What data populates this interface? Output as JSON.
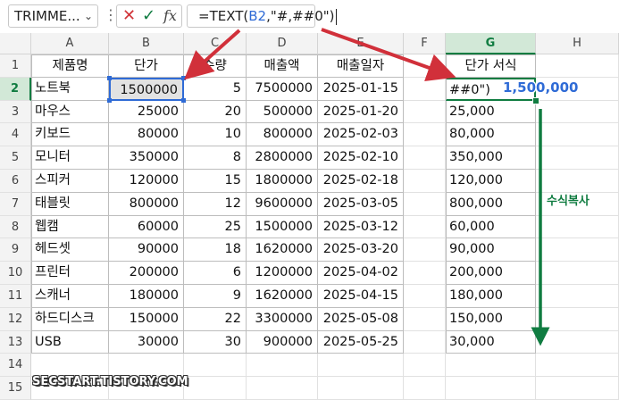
{
  "formula_bar": {
    "name_box": "TRIMME...",
    "formula_prefix": "=TEXT(",
    "formula_ref": "B2",
    "formula_suffix": ",\"#,##0\")"
  },
  "columns": [
    "A",
    "B",
    "C",
    "D",
    "E",
    "F",
    "G",
    "H"
  ],
  "rows": [
    "1",
    "2",
    "3",
    "4",
    "5",
    "6",
    "7",
    "8",
    "9",
    "10",
    "11",
    "12",
    "13",
    "14",
    "15"
  ],
  "headers": {
    "product": "제품명",
    "price": "단가",
    "qty": "수량",
    "sales": "매출액",
    "date": "매출일자",
    "price_format": "단가 서식"
  },
  "table": [
    {
      "product": "노트북",
      "price": "1500000",
      "qty": "5",
      "sales": "7500000",
      "date": "2025-01-15",
      "formatted": "##0\")"
    },
    {
      "product": "마우스",
      "price": "25000",
      "qty": "20",
      "sales": "500000",
      "date": "2025-01-20",
      "formatted": "25,000"
    },
    {
      "product": "키보드",
      "price": "80000",
      "qty": "10",
      "sales": "800000",
      "date": "2025-02-03",
      "formatted": "80,000"
    },
    {
      "product": "모니터",
      "price": "350000",
      "qty": "8",
      "sales": "2800000",
      "date": "2025-02-10",
      "formatted": "350,000"
    },
    {
      "product": "스피커",
      "price": "120000",
      "qty": "15",
      "sales": "1800000",
      "date": "2025-02-18",
      "formatted": "120,000"
    },
    {
      "product": "태블릿",
      "price": "800000",
      "qty": "12",
      "sales": "9600000",
      "date": "2025-03-05",
      "formatted": "800,000"
    },
    {
      "product": "웹캠",
      "price": "60000",
      "qty": "25",
      "sales": "1500000",
      "date": "2025-03-12",
      "formatted": "60,000"
    },
    {
      "product": "헤드셋",
      "price": "90000",
      "qty": "18",
      "sales": "1620000",
      "date": "2025-03-20",
      "formatted": "90,000"
    },
    {
      "product": "프린터",
      "price": "200000",
      "qty": "6",
      "sales": "1200000",
      "date": "2025-04-02",
      "formatted": "200,000"
    },
    {
      "product": "스캐너",
      "price": "180000",
      "qty": "9",
      "sales": "1620000",
      "date": "2025-04-15",
      "formatted": "180,000"
    },
    {
      "product": "하드디스크",
      "price": "150000",
      "qty": "22",
      "sales": "3300000",
      "date": "2025-05-08",
      "formatted": "150,000"
    },
    {
      "product": "USB",
      "price": "30000",
      "qty": "30",
      "sales": "900000",
      "date": "2025-05-25",
      "formatted": "30,000"
    }
  ],
  "annotations": {
    "result_preview": "1,500,000",
    "copy_formula": "수식복사",
    "watermark": "SECSTART.TISTORY.COM"
  },
  "colors": {
    "excel_green": "#107c41",
    "ref_blue": "#2f6bd6",
    "arrow_red": "#d1303a"
  }
}
